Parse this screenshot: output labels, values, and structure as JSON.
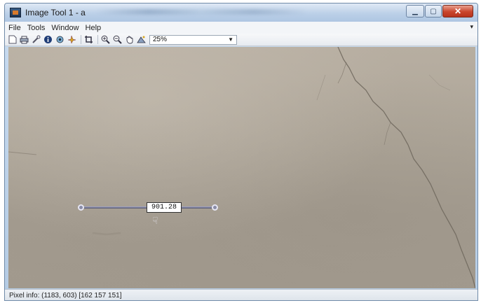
{
  "window": {
    "title": "Image Tool 1 - a"
  },
  "menu": {
    "items": [
      "File",
      "Tools",
      "Window",
      "Help"
    ],
    "dock_arrow": "▾"
  },
  "toolbar": {
    "icons": [
      "new-figure-icon",
      "print-icon",
      "inspect-icon",
      "info-icon",
      "eye-icon",
      "pixel-region-icon",
      "crop-icon",
      "zoom-in-icon",
      "zoom-out-icon",
      "pan-icon",
      "adjust-contrast-icon"
    ],
    "zoom_value": "25%",
    "zoom_arrow": "▼"
  },
  "measurement": {
    "distance_label": "901.28"
  },
  "status": {
    "pixel_info": "Pixel info: (1183, 603)  [162 157 151]"
  },
  "colors": {
    "surface": "#aea699",
    "measure_line": "#7d7f99",
    "close_button": "#c9452c"
  }
}
